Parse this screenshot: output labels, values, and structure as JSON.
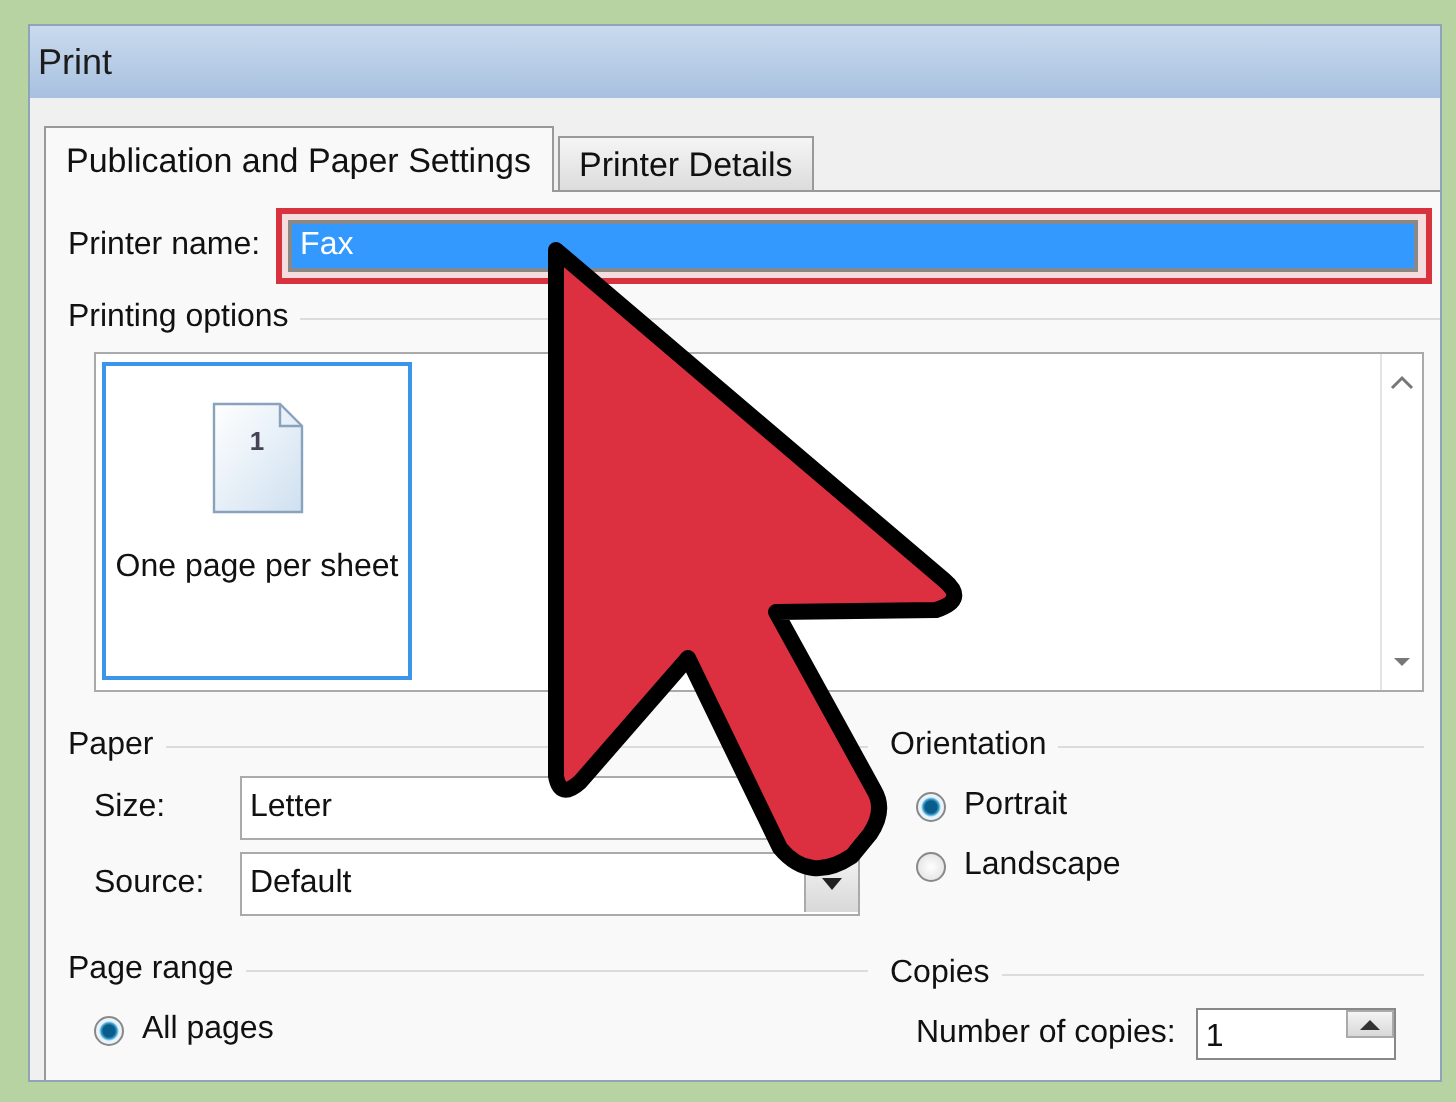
{
  "window": {
    "title": "Print"
  },
  "tabs": [
    {
      "label": "Publication and Paper Settings",
      "selected": true
    },
    {
      "label": "Printer Details",
      "selected": false
    }
  ],
  "printer": {
    "label": "Printer name:",
    "value": "Fax",
    "highlighted": true
  },
  "printing_options": {
    "heading": "Printing options",
    "items": [
      {
        "label": "One page per sheet",
        "page_number": "1",
        "selected": true
      }
    ]
  },
  "paper": {
    "heading": "Paper",
    "fields": [
      {
        "label": "Size:",
        "value": "Letter"
      },
      {
        "label": "Source:",
        "value": "Default",
        "dropdown_button": true
      }
    ]
  },
  "orientation": {
    "heading": "Orientation",
    "options": [
      {
        "label": "Portrait",
        "selected": true
      },
      {
        "label": "Landscape",
        "selected": false
      }
    ]
  },
  "page_range": {
    "heading": "Page range",
    "options": [
      {
        "label": "All pages",
        "selected": true
      }
    ]
  },
  "copies": {
    "heading": "Copies",
    "label": "Number of copies:",
    "value": "1"
  }
}
